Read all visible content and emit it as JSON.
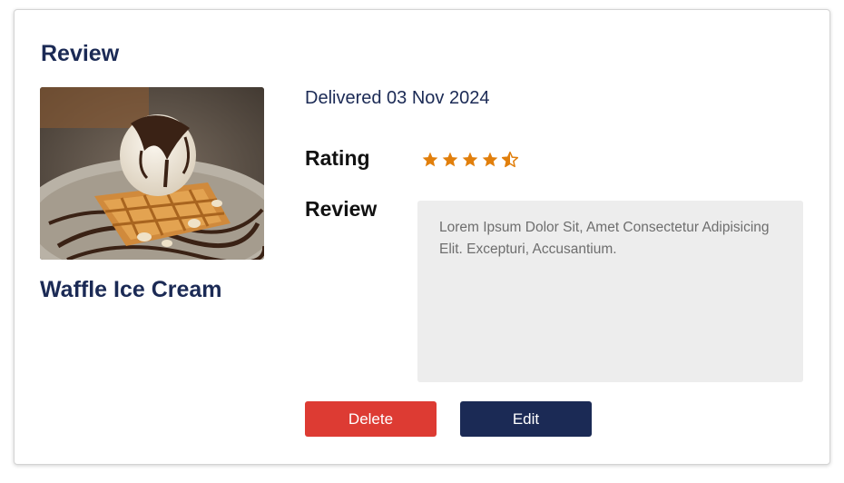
{
  "card": {
    "heading": "Review",
    "food_name": "Waffle Ice Cream",
    "image_alt": "Waffle Ice Cream",
    "delivered": "Delivered 03 Nov 2024",
    "rating_label": "Rating",
    "rating_value": 4.5,
    "rating_max": 5,
    "star_color": "#e17f0c",
    "review_label": "Review",
    "review_text": "Lorem Ipsum Dolor Sit, Amet Consectetur Adipisicing Elit. Excepturi, Accusantium.",
    "delete_label": "Delete",
    "edit_label": "Edit",
    "colors": {
      "primary": "#1b2a55",
      "danger": "#dd3b33",
      "review_bg": "#ededed"
    }
  }
}
